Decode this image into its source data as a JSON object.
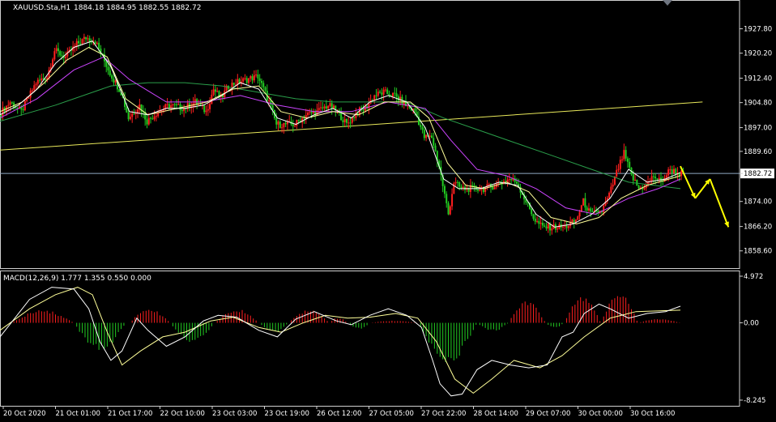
{
  "chart_data": [
    {
      "type": "candlestick",
      "header": {
        "symbol_label": "XAUUSD.Sta,H1",
        "ohlc_label": "1884.18 1884.95 1882.55 1882.72"
      },
      "ylim": [
        1855.0,
        1935.0
      ],
      "y_ticks": [
        "1927.80",
        "1920.20",
        "1912.40",
        "1904.80",
        "1897.00",
        "1889.60",
        "1882.72",
        "1874.00",
        "1866.20",
        "1858.60"
      ],
      "x_ticks": [
        "20 Oct 2020",
        "21 Oct 01:00",
        "21 Oct 17:00",
        "22 Oct 10:00",
        "23 Oct 03:00",
        "23 Oct 19:00",
        "26 Oct 12:00",
        "27 Oct 05:00",
        "27 Oct 22:00",
        "28 Oct 14:00",
        "29 Oct 07:00",
        "30 Oct 00:00",
        "30 Oct 16:00"
      ],
      "current_price": 1882.72,
      "colors": {
        "background": "#000000",
        "bull": "#ff1f1f",
        "bear": "#22cc22",
        "fast_ma": "#ffffff",
        "mid_ma": "#ffff99",
        "slow_ma": "#cc44ff",
        "long_ma": "#2a9e4a",
        "trendline": "#e8e85a",
        "price_line": "#8fa9c4",
        "forecast": "#ffff00",
        "axis_text": "#ffffff",
        "border": "#cfcfcf"
      },
      "close_path": [
        [
          0,
          1901
        ],
        [
          6,
          1905
        ],
        [
          12,
          1902
        ],
        [
          20,
          1911
        ],
        [
          26,
          1913
        ],
        [
          30,
          1921
        ],
        [
          36,
          1919
        ],
        [
          42,
          1923
        ],
        [
          47,
          1925
        ],
        [
          52,
          1924
        ],
        [
          56,
          1919
        ],
        [
          60,
          1914
        ],
        [
          66,
          1908
        ],
        [
          70,
          1900
        ],
        [
          76,
          1904
        ],
        [
          80,
          1899
        ],
        [
          86,
          1902
        ],
        [
          92,
          1904
        ],
        [
          100,
          1903
        ],
        [
          106,
          1905
        ],
        [
          112,
          1902
        ],
        [
          116,
          1909
        ],
        [
          120,
          1906
        ],
        [
          124,
          1910
        ],
        [
          128,
          1911
        ],
        [
          134,
          1912
        ],
        [
          140,
          1913
        ],
        [
          146,
          1905
        ],
        [
          150,
          1898
        ],
        [
          156,
          1898
        ],
        [
          160,
          1898
        ],
        [
          166,
          1901
        ],
        [
          172,
          1902
        ],
        [
          178,
          1904
        ],
        [
          183,
          1902
        ],
        [
          188,
          1898
        ],
        [
          194,
          1902
        ],
        [
          198,
          1903
        ],
        [
          203,
          1907
        ],
        [
          208,
          1908
        ],
        [
          214,
          1907
        ],
        [
          220,
          1904
        ],
        [
          225,
          1902
        ],
        [
          230,
          1894
        ],
        [
          234,
          1894
        ],
        [
          238,
          1885
        ],
        [
          240,
          1879
        ],
        [
          243,
          1870
        ],
        [
          246,
          1880
        ],
        [
          250,
          1878
        ],
        [
          256,
          1878
        ],
        [
          262,
          1878
        ],
        [
          268,
          1879
        ],
        [
          272,
          1880
        ],
        [
          276,
          1881
        ],
        [
          280,
          1880
        ],
        [
          285,
          1874
        ],
        [
          290,
          1868
        ],
        [
          294,
          1866
        ],
        [
          300,
          1866
        ],
        [
          306,
          1866
        ],
        [
          312,
          1868
        ],
        [
          316,
          1874
        ],
        [
          320,
          1870
        ],
        [
          326,
          1871
        ],
        [
          330,
          1876
        ],
        [
          334,
          1883
        ],
        [
          338,
          1889
        ],
        [
          342,
          1882
        ],
        [
          346,
          1878
        ],
        [
          350,
          1879
        ],
        [
          354,
          1882
        ],
        [
          358,
          1880
        ],
        [
          363,
          1884
        ],
        [
          368,
          1882.72
        ]
      ],
      "fast_ma": [
        [
          0,
          1901
        ],
        [
          10,
          1904
        ],
        [
          20,
          1909
        ],
        [
          30,
          1917
        ],
        [
          40,
          1922
        ],
        [
          50,
          1924
        ],
        [
          60,
          1916
        ],
        [
          70,
          1902
        ],
        [
          80,
          1901
        ],
        [
          90,
          1903
        ],
        [
          100,
          1903
        ],
        [
          110,
          1904
        ],
        [
          120,
          1907
        ],
        [
          130,
          1911
        ],
        [
          140,
          1909
        ],
        [
          150,
          1900
        ],
        [
          160,
          1898
        ],
        [
          170,
          1901
        ],
        [
          180,
          1903
        ],
        [
          190,
          1900
        ],
        [
          200,
          1905
        ],
        [
          210,
          1907
        ],
        [
          220,
          1905
        ],
        [
          230,
          1897
        ],
        [
          240,
          1881
        ],
        [
          248,
          1878
        ],
        [
          260,
          1878
        ],
        [
          270,
          1880
        ],
        [
          280,
          1879
        ],
        [
          290,
          1870
        ],
        [
          300,
          1866
        ],
        [
          310,
          1867
        ],
        [
          320,
          1870
        ],
        [
          330,
          1875
        ],
        [
          340,
          1884
        ],
        [
          350,
          1880
        ],
        [
          360,
          1881
        ],
        [
          368,
          1883
        ]
      ],
      "mid_ma": [
        [
          0,
          1902
        ],
        [
          12,
          1905
        ],
        [
          24,
          1911
        ],
        [
          36,
          1918
        ],
        [
          48,
          1922
        ],
        [
          58,
          1919
        ],
        [
          68,
          1906
        ],
        [
          80,
          1901
        ],
        [
          96,
          1903
        ],
        [
          112,
          1905
        ],
        [
          126,
          1909
        ],
        [
          140,
          1910
        ],
        [
          152,
          1902
        ],
        [
          166,
          1900
        ],
        [
          180,
          1902
        ],
        [
          194,
          1901
        ],
        [
          208,
          1905
        ],
        [
          222,
          1905
        ],
        [
          232,
          1900
        ],
        [
          242,
          1886
        ],
        [
          252,
          1879
        ],
        [
          262,
          1878
        ],
        [
          274,
          1880
        ],
        [
          286,
          1877
        ],
        [
          298,
          1869
        ],
        [
          312,
          1867
        ],
        [
          324,
          1869
        ],
        [
          336,
          1875
        ],
        [
          350,
          1879
        ],
        [
          368,
          1882
        ]
      ],
      "slow_ma": [
        [
          0,
          1900
        ],
        [
          20,
          1906
        ],
        [
          40,
          1915
        ],
        [
          56,
          1919
        ],
        [
          70,
          1912
        ],
        [
          90,
          1905
        ],
        [
          110,
          1905
        ],
        [
          130,
          1907
        ],
        [
          150,
          1904
        ],
        [
          170,
          1902
        ],
        [
          190,
          1902
        ],
        [
          210,
          1905
        ],
        [
          230,
          1903
        ],
        [
          244,
          1893
        ],
        [
          258,
          1884
        ],
        [
          274,
          1882
        ],
        [
          290,
          1878
        ],
        [
          306,
          1872
        ],
        [
          322,
          1870
        ],
        [
          340,
          1875
        ],
        [
          356,
          1878
        ],
        [
          368,
          1881
        ]
      ],
      "long_ma": [
        [
          0,
          1899
        ],
        [
          30,
          1904
        ],
        [
          60,
          1910
        ],
        [
          80,
          1911
        ],
        [
          100,
          1911
        ],
        [
          120,
          1910
        ],
        [
          140,
          1908
        ],
        [
          160,
          1906
        ],
        [
          180,
          1905
        ],
        [
          200,
          1905
        ],
        [
          220,
          1905
        ],
        [
          240,
          1900
        ],
        [
          260,
          1896
        ],
        [
          280,
          1892
        ],
        [
          300,
          1888
        ],
        [
          320,
          1884
        ],
        [
          340,
          1880
        ],
        [
          368,
          1878
        ]
      ],
      "trendline": [
        [
          0,
          1890
        ],
        [
          380,
          1905
        ]
      ],
      "forecast": [
        [
          368,
          1885
        ],
        [
          376,
          1875
        ],
        [
          384,
          1881
        ],
        [
          394,
          1866
        ]
      ]
    },
    {
      "type": "macd",
      "label": "MACD(12,26,9) 1.777 1.355 0.550 0.000",
      "ylim": [
        -8.245,
        4.972
      ],
      "y_ticks": [
        "4.972",
        "0.00",
        "-8.245"
      ],
      "histogram": [
        {
          "from": 6,
          "to": 40,
          "peak": 1.2
        },
        {
          "from": 40,
          "to": 68,
          "peak": -2.6
        },
        {
          "from": 70,
          "to": 92,
          "peak": 1.3
        },
        {
          "from": 92,
          "to": 116,
          "peak": -1.8
        },
        {
          "from": 116,
          "to": 140,
          "peak": 1.3
        },
        {
          "from": 140,
          "to": 156,
          "peak": -0.9
        },
        {
          "from": 156,
          "to": 178,
          "peak": 1.3
        },
        {
          "from": 178,
          "to": 188,
          "peak": 0.5
        },
        {
          "from": 188,
          "to": 200,
          "peak": -0.6
        },
        {
          "from": 200,
          "to": 226,
          "peak": 0.2
        },
        {
          "from": 226,
          "to": 258,
          "peak": -3.8
        },
        {
          "from": 258,
          "to": 275,
          "peak": -0.8
        },
        {
          "from": 275,
          "to": 295,
          "peak": 2.1
        },
        {
          "from": 295,
          "to": 305,
          "peak": -0.5
        },
        {
          "from": 305,
          "to": 325,
          "peak": 2.4
        },
        {
          "from": 325,
          "to": 345,
          "peak": 2.8
        },
        {
          "from": 345,
          "to": 368,
          "peak": 0.4
        }
      ],
      "macd_line": [
        [
          0,
          -1.5
        ],
        [
          8,
          0.5
        ],
        [
          16,
          2.5
        ],
        [
          28,
          3.8
        ],
        [
          40,
          3.6
        ],
        [
          48,
          1.5
        ],
        [
          54,
          -2.0
        ],
        [
          60,
          -4.0
        ],
        [
          66,
          -3.0
        ],
        [
          74,
          0.5
        ],
        [
          80,
          -0.8
        ],
        [
          90,
          -2.5
        ],
        [
          100,
          -1.5
        ],
        [
          110,
          0.2
        ],
        [
          118,
          0.8
        ],
        [
          128,
          0.6
        ],
        [
          140,
          -0.8
        ],
        [
          150,
          -1.5
        ],
        [
          160,
          0.4
        ],
        [
          170,
          1.2
        ],
        [
          182,
          0.2
        ],
        [
          190,
          -0.2
        ],
        [
          200,
          0.8
        ],
        [
          210,
          1.5
        ],
        [
          220,
          0.8
        ],
        [
          228,
          -0.5
        ],
        [
          234,
          -4.0
        ],
        [
          238,
          -6.5
        ],
        [
          244,
          -7.8
        ],
        [
          250,
          -7.6
        ],
        [
          258,
          -5.0
        ],
        [
          266,
          -4.0
        ],
        [
          276,
          -4.5
        ],
        [
          286,
          -4.8
        ],
        [
          296,
          -4.5
        ],
        [
          304,
          -1.5
        ],
        [
          310,
          -1.0
        ],
        [
          316,
          1.0
        ],
        [
          324,
          2.0
        ],
        [
          330,
          1.5
        ],
        [
          340,
          0.5
        ],
        [
          350,
          1.0
        ],
        [
          360,
          1.2
        ],
        [
          368,
          1.777
        ]
      ],
      "signal_line": [
        [
          0,
          -0.8
        ],
        [
          16,
          1.5
        ],
        [
          30,
          3.0
        ],
        [
          42,
          3.8
        ],
        [
          50,
          3.0
        ],
        [
          58,
          -1.0
        ],
        [
          66,
          -4.5
        ],
        [
          76,
          -3.0
        ],
        [
          88,
          -1.5
        ],
        [
          100,
          -1.0
        ],
        [
          114,
          0.2
        ],
        [
          126,
          0.6
        ],
        [
          140,
          -0.5
        ],
        [
          152,
          -1.0
        ],
        [
          164,
          0.0
        ],
        [
          176,
          0.8
        ],
        [
          188,
          0.5
        ],
        [
          200,
          0.6
        ],
        [
          214,
          1.0
        ],
        [
          226,
          0.5
        ],
        [
          236,
          -2.0
        ],
        [
          246,
          -6.0
        ],
        [
          256,
          -7.5
        ],
        [
          266,
          -6.0
        ],
        [
          278,
          -4.0
        ],
        [
          292,
          -4.8
        ],
        [
          304,
          -3.5
        ],
        [
          316,
          -1.5
        ],
        [
          330,
          0.5
        ],
        [
          344,
          1.2
        ],
        [
          360,
          1.3
        ],
        [
          368,
          1.355
        ]
      ]
    }
  ]
}
